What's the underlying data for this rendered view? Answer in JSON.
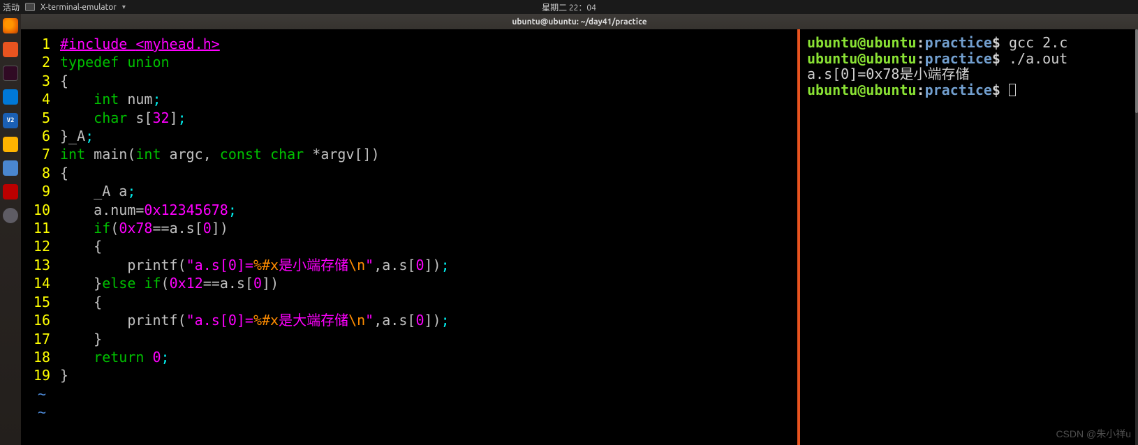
{
  "top_panel": {
    "activities": "活动",
    "app_menu": "X-terminal-emulator",
    "clock": "星期二 22：04"
  },
  "window_title": "ubuntu@ubuntu: ~/day41/practice",
  "dock": {
    "vnc_label": "V2"
  },
  "code": {
    "lines": [
      {
        "n": "1",
        "seg": [
          [
            "c-include",
            "#include "
          ],
          [
            "c-include-file",
            "<myhead.h>"
          ]
        ]
      },
      {
        "n": "2",
        "seg": [
          [
            "c-keyword",
            "typedef"
          ],
          [
            "c-gray",
            " "
          ],
          [
            "c-keyword",
            "union"
          ]
        ]
      },
      {
        "n": "3",
        "seg": [
          [
            "c-gray",
            "{"
          ]
        ]
      },
      {
        "n": "4",
        "seg": [
          [
            "c-gray",
            "    "
          ],
          [
            "c-keyword",
            "int"
          ],
          [
            "c-gray",
            " num"
          ],
          [
            "c-comma",
            ";"
          ]
        ]
      },
      {
        "n": "5",
        "seg": [
          [
            "c-gray",
            "    "
          ],
          [
            "c-keyword",
            "char"
          ],
          [
            "c-gray",
            " s["
          ],
          [
            "c-num",
            "32"
          ],
          [
            "c-gray",
            "]"
          ],
          [
            "c-comma",
            ";"
          ]
        ]
      },
      {
        "n": "6",
        "seg": [
          [
            "c-gray",
            "}_A"
          ],
          [
            "c-comma",
            ";"
          ]
        ]
      },
      {
        "n": "7",
        "seg": [
          [
            "c-keyword",
            "int"
          ],
          [
            "c-gray",
            " main("
          ],
          [
            "c-keyword",
            "int"
          ],
          [
            "c-gray",
            " argc, "
          ],
          [
            "c-keyword",
            "const"
          ],
          [
            "c-gray",
            " "
          ],
          [
            "c-keyword",
            "char"
          ],
          [
            "c-gray",
            " *argv[])"
          ]
        ]
      },
      {
        "n": "8",
        "seg": [
          [
            "c-gray",
            "{"
          ]
        ]
      },
      {
        "n": "9",
        "seg": [
          [
            "c-gray",
            "    _A a"
          ],
          [
            "c-comma",
            ";"
          ]
        ]
      },
      {
        "n": "10",
        "seg": [
          [
            "c-gray",
            "    a.num="
          ],
          [
            "c-num",
            "0x12345678"
          ],
          [
            "c-comma",
            ";"
          ]
        ]
      },
      {
        "n": "11",
        "seg": [
          [
            "c-gray",
            "    "
          ],
          [
            "c-keyword",
            "if"
          ],
          [
            "c-gray",
            "("
          ],
          [
            "c-num",
            "0x78"
          ],
          [
            "c-gray",
            "==a.s["
          ],
          [
            "c-num",
            "0"
          ],
          [
            "c-gray",
            "])"
          ]
        ]
      },
      {
        "n": "12",
        "seg": [
          [
            "c-gray",
            "    {"
          ]
        ]
      },
      {
        "n": "13",
        "seg": [
          [
            "c-gray",
            "        printf("
          ],
          [
            "c-string",
            "\"a.s[0]="
          ],
          [
            "c-escape",
            "%#x"
          ],
          [
            "c-string",
            "是小端存储"
          ],
          [
            "c-escape",
            "\\n"
          ],
          [
            "c-string",
            "\""
          ],
          [
            "c-gray",
            ",a.s["
          ],
          [
            "c-num",
            "0"
          ],
          [
            "c-gray",
            "])"
          ],
          [
            "c-comma",
            ";"
          ]
        ]
      },
      {
        "n": "14",
        "seg": [
          [
            "c-gray",
            "    }"
          ],
          [
            "c-keyword",
            "else"
          ],
          [
            "c-gray",
            " "
          ],
          [
            "c-keyword",
            "if"
          ],
          [
            "c-gray",
            "("
          ],
          [
            "c-num",
            "0x12"
          ],
          [
            "c-gray",
            "==a.s["
          ],
          [
            "c-num",
            "0"
          ],
          [
            "c-gray",
            "])"
          ]
        ]
      },
      {
        "n": "15",
        "seg": [
          [
            "c-gray",
            "    {"
          ]
        ]
      },
      {
        "n": "16",
        "seg": [
          [
            "c-gray",
            "        printf("
          ],
          [
            "c-string",
            "\"a.s[0]="
          ],
          [
            "c-escape",
            "%#x"
          ],
          [
            "c-string",
            "是大端存储"
          ],
          [
            "c-escape",
            "\\n"
          ],
          [
            "c-string",
            "\""
          ],
          [
            "c-gray",
            ",a.s["
          ],
          [
            "c-num",
            "0"
          ],
          [
            "c-gray",
            "])"
          ],
          [
            "c-comma",
            ";"
          ]
        ]
      },
      {
        "n": "17",
        "seg": [
          [
            "c-gray",
            "    }"
          ]
        ]
      },
      {
        "n": "18",
        "seg": [
          [
            "c-gray",
            "    "
          ],
          [
            "c-keyword",
            "return"
          ],
          [
            "c-gray",
            " "
          ],
          [
            "c-num",
            "0"
          ],
          [
            "c-comma",
            ";"
          ]
        ]
      },
      {
        "n": "19",
        "seg": [
          [
            "c-gray",
            "}"
          ]
        ]
      }
    ],
    "tilde": "~"
  },
  "shell": {
    "user": "ubuntu",
    "host": "ubuntu",
    "path": "practice",
    "prompt_suffix": "$",
    "lines": [
      {
        "type": "prompt",
        "cmd": " gcc 2.c"
      },
      {
        "type": "prompt",
        "cmd": " ./a.out"
      },
      {
        "type": "output",
        "text": "a.s[0]=0x78是小端存储"
      },
      {
        "type": "prompt",
        "cmd": " ",
        "cursor": true
      }
    ]
  },
  "watermark": "CSDN @朱小祥u"
}
